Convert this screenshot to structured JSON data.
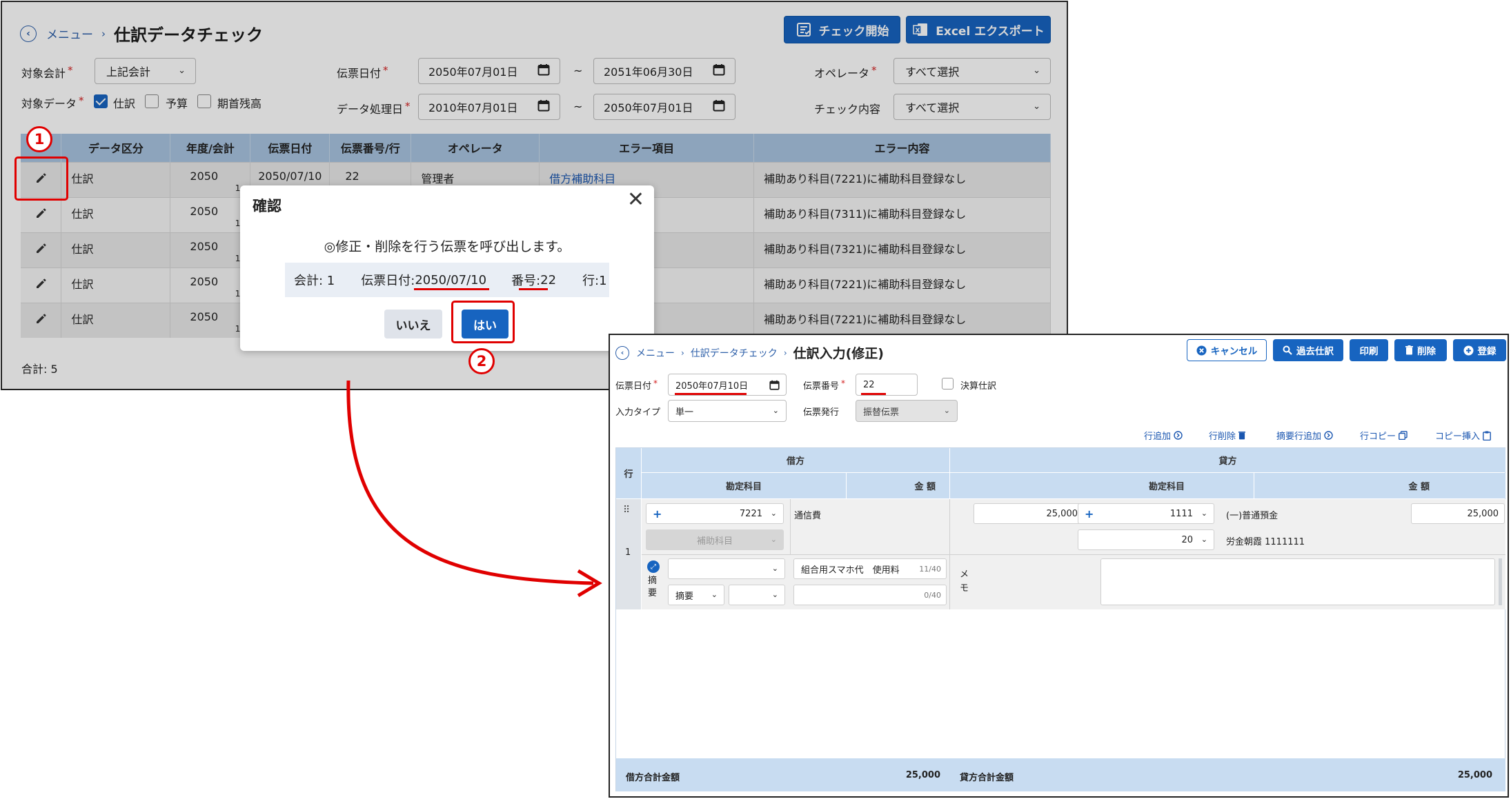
{
  "screen1": {
    "breadcrumb": {
      "menu": "メニュー",
      "title": "仕訳データチェック"
    },
    "buttons": {
      "check_start": "チェック開始",
      "excel_export": "Excel エクスポート"
    },
    "filters": {
      "target_accounting_label": "対象会計",
      "target_accounting_value": "上記会計",
      "slip_date_label": "伝票日付",
      "slip_date_from": "2050年07月01日",
      "slip_date_to": "2051年06月30日",
      "operator_label": "オペレータ",
      "operator_value": "すべて選択",
      "target_data_label": "対象データ",
      "target_data_options": [
        {
          "label": "仕訳",
          "checked": true
        },
        {
          "label": "予算",
          "checked": false
        },
        {
          "label": "期首残高",
          "checked": false
        }
      ],
      "processing_date_label": "データ処理日",
      "processing_date_from": "2010年07月01日",
      "processing_date_to": "2050年07月01日",
      "check_content_label": "チェック内容",
      "check_content_value": "すべて選択",
      "tilde": "~",
      "required_mark": "*"
    },
    "table": {
      "headers": [
        "",
        "データ区分",
        "年度/会計",
        "伝票日付",
        "伝票番号/行",
        "オペレータ",
        "エラー項目",
        "エラー内容"
      ],
      "rows": [
        {
          "kubun": "仕訳",
          "year": "2050",
          "acct": "1",
          "date": "2050/07/10",
          "no": "22",
          "operator": "管理者",
          "error_item": "借方補助科目",
          "error_content": "補助あり科目(7221)に補助科目登録なし"
        },
        {
          "kubun": "仕訳",
          "year": "2050",
          "acct": "1",
          "date": "",
          "no": "",
          "operator": "",
          "error_item": "",
          "error_content": "補助あり科目(7311)に補助科目登録なし"
        },
        {
          "kubun": "仕訳",
          "year": "2050",
          "acct": "1",
          "date": "",
          "no": "",
          "operator": "",
          "error_item": "",
          "error_content": "補助あり科目(7321)に補助科目登録なし"
        },
        {
          "kubun": "仕訳",
          "year": "2050",
          "acct": "1",
          "date": "",
          "no": "",
          "operator": "",
          "error_item": "",
          "error_content": "補助あり科目(7221)に補助科目登録なし"
        },
        {
          "kubun": "仕訳",
          "year": "2050",
          "acct": "1",
          "date": "",
          "no": "",
          "operator": "",
          "error_item": "",
          "error_content": "補助あり科目(7221)に補助科目登録なし"
        }
      ]
    },
    "total": "合計: 5"
  },
  "dialog": {
    "title": "確認",
    "close": "✕",
    "message": "◎修正・削除を行う伝票を呼び出します。",
    "info": {
      "kaikei": "会計: 1",
      "date_label": "伝票日付: ",
      "date_value": "2050/07/10",
      "no_label": "番号: ",
      "no_value": "22",
      "row": "行:1"
    },
    "no_button": "いいえ",
    "yes_button": "はい"
  },
  "annotations": {
    "step1": "1",
    "step2": "2",
    "accent_color": "#e00000"
  },
  "screen2": {
    "breadcrumb": {
      "menu": "メニュー",
      "parent": "仕訳データチェック",
      "title": "仕訳入力(修正)"
    },
    "buttons": {
      "cancel": "キャンセル",
      "past": "過去仕訳",
      "print": "印刷",
      "delete": "削除",
      "register": "登録"
    },
    "form": {
      "slip_date_label": "伝票日付",
      "slip_date_value": "2050年07月10日",
      "slip_no_label": "伝票番号",
      "slip_no_value": "22",
      "closing_label": "決算仕訳",
      "input_type_label": "入力タイプ",
      "input_type_value": "単一",
      "slip_issue_label": "伝票発行",
      "slip_issue_value": "振替伝票",
      "required_mark": "*"
    },
    "actions": [
      "行追加",
      "行削除",
      "摘要行追加",
      "行コピー",
      "コピー挿入"
    ],
    "grid": {
      "row_header": "行",
      "debit_header": "借方",
      "credit_header": "貸方",
      "account_header": "勘定科目",
      "amount_header": "金 額",
      "row_no": "1",
      "debit": {
        "code": "7221",
        "name": "通信費",
        "amount": "25,000",
        "sub_placeholder": "補助科目"
      },
      "credit": {
        "code": "1111",
        "name": "(一)普通預金",
        "amount": "25,000",
        "sub_code": "20",
        "sub_name": "労金朝霞 1111111"
      },
      "summary_label": "摘要",
      "summary_select": "摘要",
      "summary_text": "組合用スマホ代　使用料",
      "summary_count1": "11/40",
      "summary_count2": "0/40",
      "memo_label": "メモ"
    },
    "footer": {
      "debit_total_label": "借方合計金額",
      "debit_total": "25,000",
      "credit_total_label": "貸方合計金額",
      "credit_total": "25,000"
    }
  },
  "colors": {
    "primary": "#1764c0",
    "header_bg": "#a8c4e0",
    "grid_header": "#c8dcf1",
    "arrow": "#e00000"
  }
}
